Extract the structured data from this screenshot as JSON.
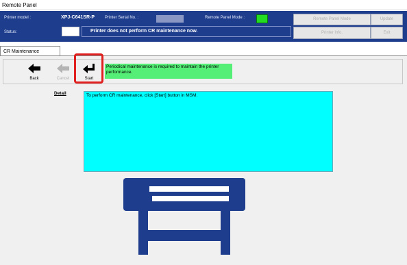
{
  "window": {
    "title": "Remote Panel"
  },
  "header": {
    "printer_model_label": "Printer model :",
    "printer_model_value": "XPJ-C641SR-P",
    "serial_label": "Printer Serial No. :",
    "remote_mode_label": "Remote Panel Mode :",
    "status_label": "Status:",
    "status_message": "Printer does not perform CR maintenance now.",
    "buttons": {
      "remote_panel_mode": "Remote Panel Mode",
      "update": "Update",
      "printer_info": "Printer Info.",
      "exit": "Exit"
    }
  },
  "tabs": [
    {
      "label": "CR Maintenance"
    }
  ],
  "toolbar": {
    "back": "Back",
    "cancel": "Cancel",
    "start": "Start",
    "notice": "Periodical maintenance is required to maintain the printer performance."
  },
  "detail": {
    "label": "Detail",
    "text": "To perform CR maintenance, click [Start] button in MSM."
  },
  "colors": {
    "header_bg": "#1e3d8c",
    "detail_bg": "#00ffff",
    "notice_bg": "#55ee77",
    "highlight": "#e0201e",
    "printer_icon": "#1e3d8c"
  }
}
